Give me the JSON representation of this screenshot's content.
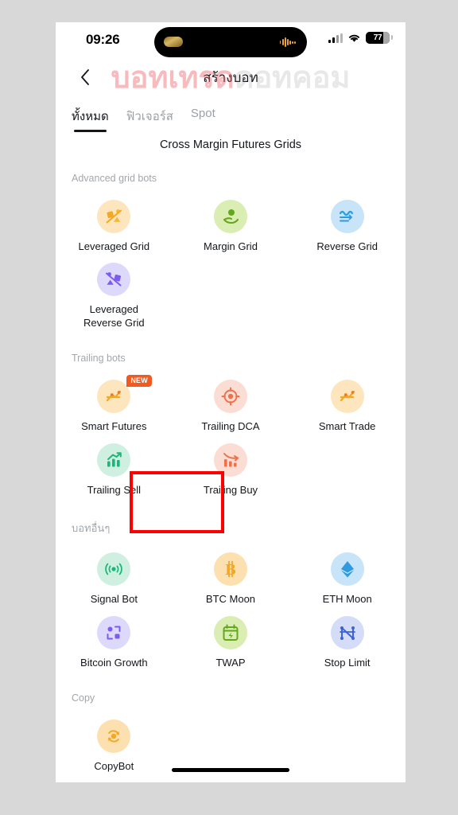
{
  "status_bar": {
    "time": "09:26",
    "battery_level": "77",
    "signal_icon": "cellular-signal-icon",
    "wifi_icon": "wifi-icon",
    "battery_icon": "battery-icon",
    "dynamic_island": "dynamic-island"
  },
  "watermark": {
    "text_primary": "บอทเทรด",
    "text_secondary": "ดอทคอม",
    "color_primary": "#F05A64",
    "color_secondary": "#8C8C8C"
  },
  "nav": {
    "back_icon": "chevron-left-icon",
    "title": "สร้างบอท"
  },
  "tabs": [
    {
      "label": "ทั้งหมด",
      "active": true
    },
    {
      "label": "ฟิวเจอร์ส",
      "active": false
    },
    {
      "label": "Spot",
      "active": false
    }
  ],
  "subtitle": "Cross Margin Futures Grids",
  "sections": [
    {
      "label": "Advanced grid bots",
      "items": [
        {
          "label": "Leveraged Grid",
          "icon": "scale-balance-icon",
          "bg": "#FDE6BE",
          "fg": "#F5A623",
          "badge": null
        },
        {
          "label": "Margin Grid",
          "icon": "hand-coin-icon",
          "bg": "#DAEEB4",
          "fg": "#63A81B",
          "badge": null
        },
        {
          "label": "Reverse Grid",
          "icon": "wave-down-icon",
          "bg": "#C7E4F8",
          "fg": "#2E9BE0",
          "badge": null
        },
        {
          "label": "Leveraged Reverse Grid",
          "icon": "scale-balance-icon",
          "bg": "#DDD9FB",
          "fg": "#7C5CF0",
          "badge": null
        }
      ]
    },
    {
      "label": "Trailing bots",
      "items": [
        {
          "label": "Smart Futures",
          "icon": "trend-node-icon",
          "bg": "#FDE6BE",
          "fg": "#F5A623",
          "badge": "NEW"
        },
        {
          "label": "Trailing DCA",
          "icon": "target-icon",
          "bg": "#FBDDD3",
          "fg": "#F0704A",
          "badge": null
        },
        {
          "label": "Smart Trade",
          "icon": "trend-node-icon",
          "bg": "#FDE6BE",
          "fg": "#F5A623",
          "badge": null
        },
        {
          "label": "Trailing Sell",
          "icon": "bar-chart-up-icon",
          "bg": "#CFF0E1",
          "fg": "#17B878",
          "badge": null
        },
        {
          "label": "Trailing Buy",
          "icon": "bar-chart-down-icon",
          "bg": "#FBDDD3",
          "fg": "#F0704A",
          "badge": null
        }
      ]
    },
    {
      "label": "บอทอื่นๆ",
      "thai": true,
      "items": [
        {
          "label": "Signal Bot",
          "icon": "signal-broadcast-icon",
          "bg": "#CFF0E1",
          "fg": "#17B878",
          "badge": null
        },
        {
          "label": "BTC Moon",
          "icon": "bitcoin-icon",
          "bg": "#FDE0B0",
          "fg": "#F5A623",
          "badge": null
        },
        {
          "label": "ETH Moon",
          "icon": "ethereum-icon",
          "bg": "#C7E4F8",
          "fg": "#2E9BE0",
          "badge": null
        },
        {
          "label": "Bitcoin Growth",
          "icon": "growth-squares-icon",
          "bg": "#DDD9FB",
          "fg": "#7C5CF0",
          "badge": null
        },
        {
          "label": "TWAP",
          "icon": "calendar-bolt-icon",
          "bg": "#DAEEB4",
          "fg": "#63A81B",
          "badge": null
        },
        {
          "label": "Stop Limit",
          "icon": "network-nodes-icon",
          "bg": "#D4DCF8",
          "fg": "#3C63D6",
          "badge": null
        }
      ]
    },
    {
      "label": "Copy",
      "items": [
        {
          "label": "CopyBot",
          "icon": "copy-refresh-icon",
          "bg": "#FDE0B0",
          "fg": "#F5A623",
          "badge": null
        }
      ]
    }
  ],
  "highlight": {
    "target": "Trailing Sell",
    "color": "#FF0000"
  }
}
